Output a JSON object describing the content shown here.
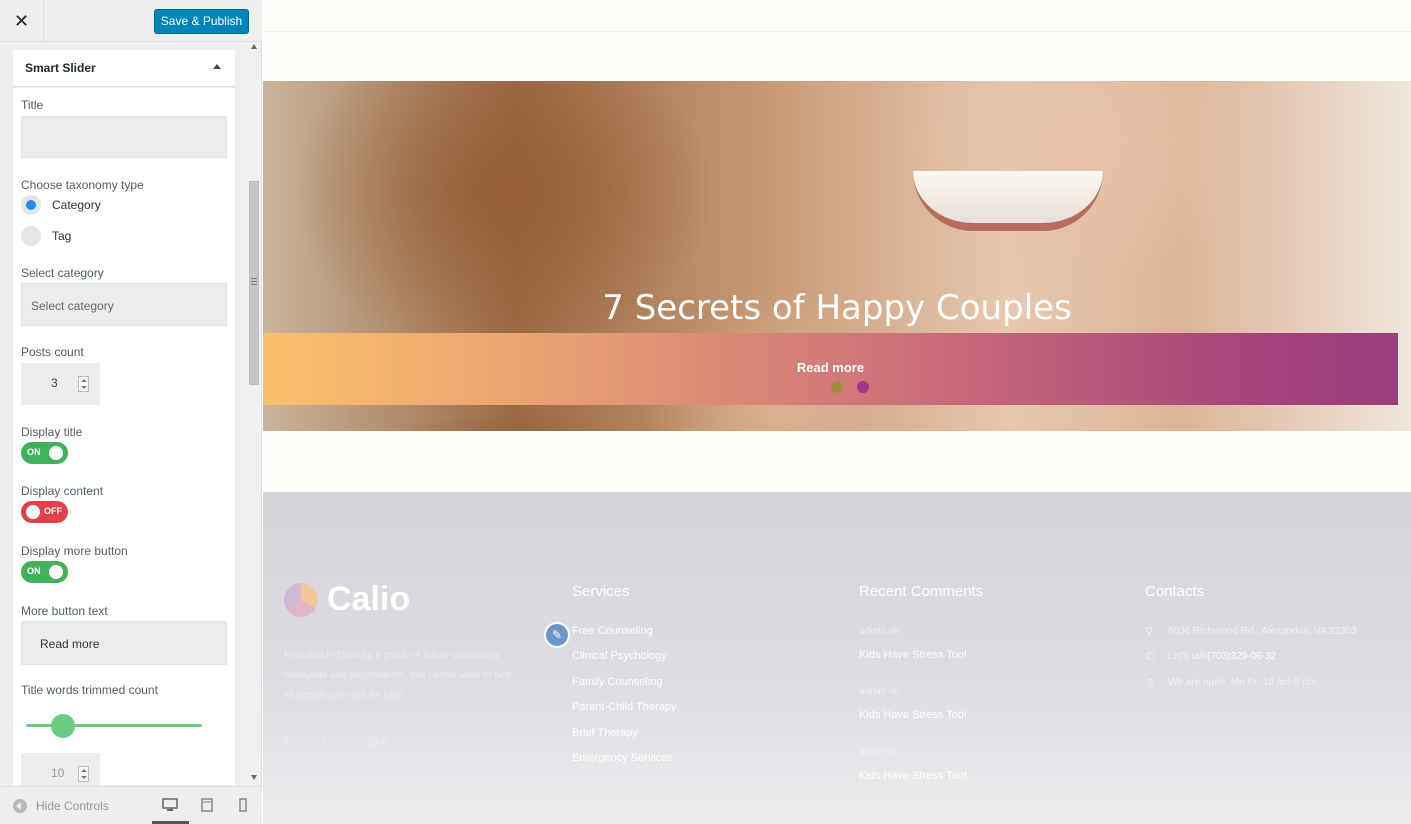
{
  "panel": {
    "close_glyph": "✕",
    "save_label": "Save & Publish",
    "section_title": "Smart Slider",
    "title_label": "Title",
    "title_value": "",
    "taxonomy_label": "Choose taxonomy type",
    "taxonomy_options": [
      "Category",
      "Tag"
    ],
    "taxonomy_selected": "Category",
    "select_category_label": "Select category",
    "select_category_placeholder": "Select category",
    "posts_count_label": "Posts count",
    "posts_count_value": "3",
    "display_title_label": "Display title",
    "display_title_state": "ON",
    "display_content_label": "Display content",
    "display_content_state": "OFF",
    "display_more_label": "Display more button",
    "display_more_state": "ON",
    "more_text_label": "More button text",
    "more_text_value": "Read more",
    "trim_label": "Title words trimmed count",
    "trim_value": "10",
    "hide_controls": "Hide Controls"
  },
  "preview": {
    "slide_title": "7 Secrets of Happy Couples",
    "read_more": "Read more",
    "active_dot": 2,
    "footer": {
      "logo": "Calio",
      "about": "Founded in 1999 by a group of fellow counseling therapists and psychiatrists, this center aims to help all people who ask for help.",
      "social_icons": [
        "f",
        "t",
        "G+"
      ],
      "services_title": "Services",
      "services": [
        "Free Counseling",
        "Clinical Psychology",
        "Family Counseling",
        "Parent-Child Therapy",
        "Brief Therapy",
        "Emergency Services"
      ],
      "comments_title": "Recent Comments",
      "comments": [
        {
          "author": "admin",
          "on": "on",
          "post": "Kids Have Stress Too!"
        },
        {
          "author": "admin",
          "on": "on",
          "post": "Kids Have Stress Too!"
        },
        {
          "author": "admin",
          "on": "on",
          "post": "Kids Have Stress Too!"
        }
      ],
      "contacts_title": "Contacts",
      "address": "6036 Richmond Rd., Alexandria, VA 22303",
      "phone_prefix": "Let's talk",
      "phone": "(703)329-06-32",
      "hours": "We are open: Mn-Fr: 10 am-8 pm"
    }
  },
  "colors": {
    "accent": "#0085ba",
    "toggle_on": "#3fb25b",
    "toggle_off": "#e33f49",
    "gradient_start": "#fbbf6a",
    "gradient_end": "#9a3d7c"
  }
}
